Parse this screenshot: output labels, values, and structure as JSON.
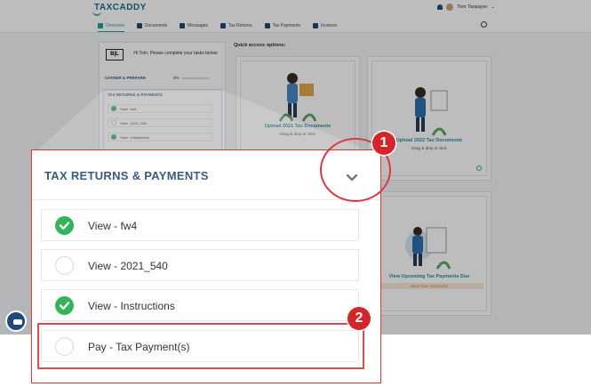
{
  "app": {
    "logo": "TAXCADDY",
    "user_name": "Tom Taxpayer",
    "nav": [
      {
        "label": "Overview",
        "active": true
      },
      {
        "label": "Documents",
        "active": false
      },
      {
        "label": "Messages",
        "active": false
      },
      {
        "label": "Tax Returns",
        "active": false
      },
      {
        "label": "Tax Payments",
        "active": false
      },
      {
        "label": "Invoices",
        "active": false
      }
    ]
  },
  "left_panel": {
    "logo_text": "B|L",
    "greeting": "Hi Tom, Please complete your tasks below:",
    "gather_label": "GATHER & PREPARE",
    "gather_pct": "0%",
    "section_title": "TAX RETURNS & PAYMENTS",
    "mini_items": [
      {
        "label": "View - fw4",
        "done": true
      },
      {
        "label": "View - 2021_540",
        "done": false
      },
      {
        "label": "View - Instructions",
        "done": true
      }
    ]
  },
  "quick_access": {
    "label": "Quick access options:",
    "cards": [
      {
        "title": "Upload 2021 Tax Documents",
        "sub": "Drag & drop or click"
      },
      {
        "title": "Upload 2022 Tax Documents",
        "sub": "Drag & drop or click"
      },
      {
        "title": "View Upcoming Tax Payments Due",
        "due": "NEXT DUE: 06/15/2023"
      }
    ]
  },
  "zoom": {
    "title": "TAX RETURNS & PAYMENTS",
    "items": [
      {
        "label": "View - fw4",
        "done": true
      },
      {
        "label": "View - 2021_540",
        "done": false
      },
      {
        "label": "View - Instructions",
        "done": true
      },
      {
        "label": "Pay - Tax Payment(s)",
        "done": false
      }
    ]
  },
  "annotations": {
    "badge_1": "1",
    "badge_2": "2",
    "color": "#d3262a"
  }
}
